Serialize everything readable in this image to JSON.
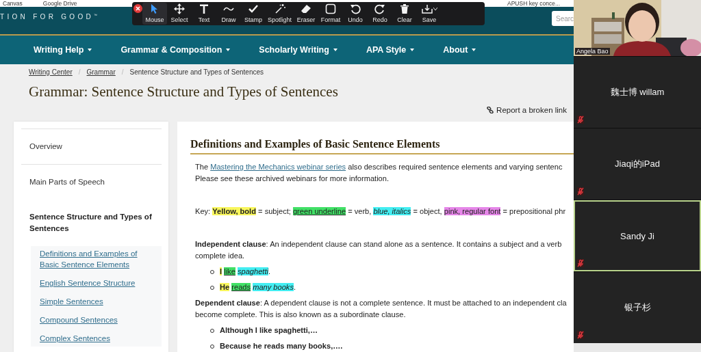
{
  "bookmarks": [
    {
      "label": "Canvas"
    },
    {
      "label": "Google Drive"
    },
    {
      "label": "APUSH key conce..."
    }
  ],
  "annotation_toolbar": {
    "tools": [
      {
        "kind": "mouse",
        "label": "Mouse",
        "selected": true
      },
      {
        "kind": "select",
        "label": "Select",
        "selected": false
      },
      {
        "kind": "text",
        "label": "Text",
        "selected": false
      },
      {
        "kind": "draw",
        "label": "Draw",
        "selected": false
      },
      {
        "kind": "stamp",
        "label": "Stamp",
        "selected": false
      },
      {
        "kind": "spotlight",
        "label": "Spotlight",
        "selected": false
      },
      {
        "kind": "eraser",
        "label": "Eraser",
        "selected": false
      },
      {
        "kind": "format",
        "label": "Format",
        "selected": false
      },
      {
        "kind": "undo",
        "label": "Undo",
        "selected": false
      },
      {
        "kind": "redo",
        "label": "Redo",
        "selected": false
      },
      {
        "kind": "clear",
        "label": "Clear",
        "selected": false
      },
      {
        "kind": "save",
        "label": "Save",
        "selected": false
      }
    ]
  },
  "site": {
    "tagline": "TION FOR GOOD$^{™}$",
    "search": {
      "placeholder": "Searc"
    },
    "nav": [
      {
        "label": "Writing Help"
      },
      {
        "label": "Grammar & Composition"
      },
      {
        "label": "Scholarly Writing"
      },
      {
        "label": "APA Style"
      },
      {
        "label": "About"
      }
    ]
  },
  "breadcrumb": [
    {
      "kind": "link",
      "text": "Writing Center"
    },
    {
      "kind": "separator",
      "text": "/"
    },
    {
      "kind": "link",
      "text": "Grammar"
    },
    {
      "kind": "separator",
      "text": "/"
    },
    {
      "kind": "current",
      "text": "Sentence Structure and Types of Sentences"
    }
  ],
  "page_title": "Grammar: Sentence Structure and Types of Sentences",
  "report_link": "Report a broken link",
  "sidebar": {
    "items": [
      {
        "label": "Overview",
        "selected": false
      },
      {
        "label": "Main Parts of Speech",
        "selected": false
      },
      {
        "label": "Sentence Structure and Types of Sentences",
        "selected": true,
        "children": [
          {
            "label": "Definitions and Examples of Basic Sentence Elements"
          },
          {
            "label": "English Sentence Structure"
          },
          {
            "label": "Simple Sentences"
          },
          {
            "label": "Compound Sentences"
          },
          {
            "label": "Complex Sentences"
          }
        ]
      }
    ]
  },
  "article": {
    "heading": "Definitions and Examples of Basic Sentence Elements",
    "blocks": [
      {
        "kind": "paragraph",
        "lines": [
          [
            {
              "kind": "plain",
              "text": "The "
            },
            {
              "kind": "link",
              "text": "Mastering the Mechanics webinar series"
            },
            {
              "kind": "plain",
              "text": " also describes required sentence elements and varying sentenc"
            }
          ],
          [
            {
              "kind": "plain",
              "text": "Please see these archived webinars for more information."
            }
          ]
        ]
      },
      {
        "kind": "paragraph",
        "lines": [
          [
            {
              "kind": "plain",
              "text": "Key: "
            },
            {
              "kind": "subject",
              "text": "Yellow, bold"
            },
            {
              "kind": "plain",
              "text": " = subject; "
            },
            {
              "kind": "verb",
              "text": "green underline"
            },
            {
              "kind": "plain",
              "text": " = verb, "
            },
            {
              "kind": "object",
              "text": "blue, italics"
            },
            {
              "kind": "plain",
              "text": " = object, "
            },
            {
              "kind": "phrase",
              "text": "pink, regular font"
            },
            {
              "kind": "plain",
              "text": " = prepositional phr"
            }
          ]
        ]
      },
      {
        "kind": "paragraph",
        "lines": [
          [
            {
              "kind": "bold",
              "text": "Independent clause"
            },
            {
              "kind": "plain",
              "text": ": An independent clause can stand alone as a sentence. It contains a subject and a verb"
            }
          ],
          [
            {
              "kind": "plain",
              "text": "complete idea."
            }
          ]
        ]
      },
      {
        "kind": "bullet",
        "lines": [
          [
            {
              "kind": "subject",
              "text": "I"
            },
            {
              "kind": "verb",
              "text": "like",
              "space_before": true
            },
            {
              "kind": "object",
              "text": "spaghetti",
              "space_before": true
            },
            {
              "kind": "plain",
              "text": "."
            }
          ]
        ]
      },
      {
        "kind": "bullet",
        "lines": [
          [
            {
              "kind": "subject",
              "text": "He"
            },
            {
              "kind": "verb",
              "text": "reads",
              "space_before": true
            },
            {
              "kind": "object",
              "text": "many books",
              "space_before": true
            },
            {
              "kind": "plain",
              "text": "."
            }
          ]
        ]
      },
      {
        "kind": "paragraph",
        "lines": [
          [
            {
              "kind": "bold",
              "text": "Dependent clause"
            },
            {
              "kind": "plain",
              "text": ": A dependent clause is not a complete sentence. It must be attached to an independent cla"
            }
          ],
          [
            {
              "kind": "plain",
              "text": "become complete. This is also known as a subordinate clause."
            }
          ]
        ]
      },
      {
        "kind": "bullet",
        "lines": [
          [
            {
              "kind": "bold",
              "text": "Although I like spaghetti,…"
            }
          ]
        ]
      },
      {
        "kind": "bullet",
        "lines": [
          [
            {
              "kind": "bold",
              "text": "Because he reads many books,…."
            }
          ]
        ]
      }
    ]
  },
  "participants": [
    {
      "kind": "video",
      "name": "Angela Bao",
      "muted": false,
      "speaking": false
    },
    {
      "kind": "name",
      "name": "魏士博 willam",
      "muted": true,
      "speaking": false
    },
    {
      "kind": "name",
      "name": "Jiaqi的iPad",
      "muted": true,
      "speaking": false
    },
    {
      "kind": "name",
      "name": "Sandy Ji",
      "muted": true,
      "speaking": true
    },
    {
      "kind": "name",
      "name": "银子杉",
      "muted": true,
      "speaking": false
    }
  ]
}
